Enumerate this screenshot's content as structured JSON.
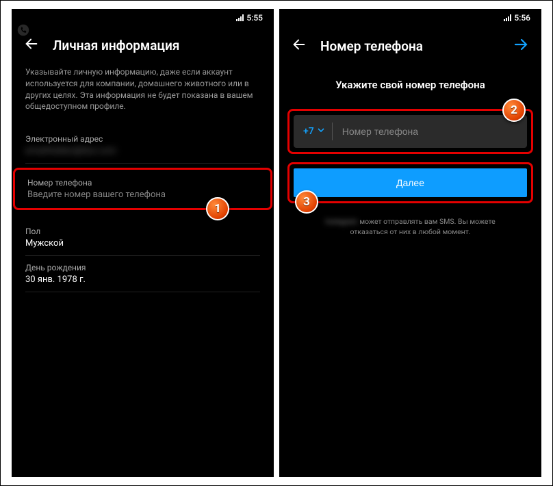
{
  "screen1": {
    "time": "5:55",
    "title": "Личная информация",
    "description": "Указывайте личную информацию, даже если аккаунт используется для компании, домашнего животного или в других целях. Эта информация не будет показана в вашем общедоступном профиле.",
    "email_label": "Электронный адрес",
    "email_value": "emailhidden@blur.com",
    "phone_label": "Номер телефона",
    "phone_placeholder": "Введите номер вашего телефона",
    "gender_label": "Пол",
    "gender_value": "Мужской",
    "birthday_label": "День рождения",
    "birthday_value": "30 янв. 1978 г."
  },
  "screen2": {
    "time": "5:56",
    "title": "Номер телефона",
    "subtitle": "Укажите свой номер телефона",
    "country_code": "+7",
    "input_placeholder": "Номер телефона",
    "next_button": "Далее",
    "disclaimer_hidden": "Instagram",
    "disclaimer_rest": "может отправлять вам SMS. Вы можете отказаться от них в любой момент."
  },
  "callouts": {
    "c1": "1",
    "c2": "2",
    "c3": "3"
  }
}
